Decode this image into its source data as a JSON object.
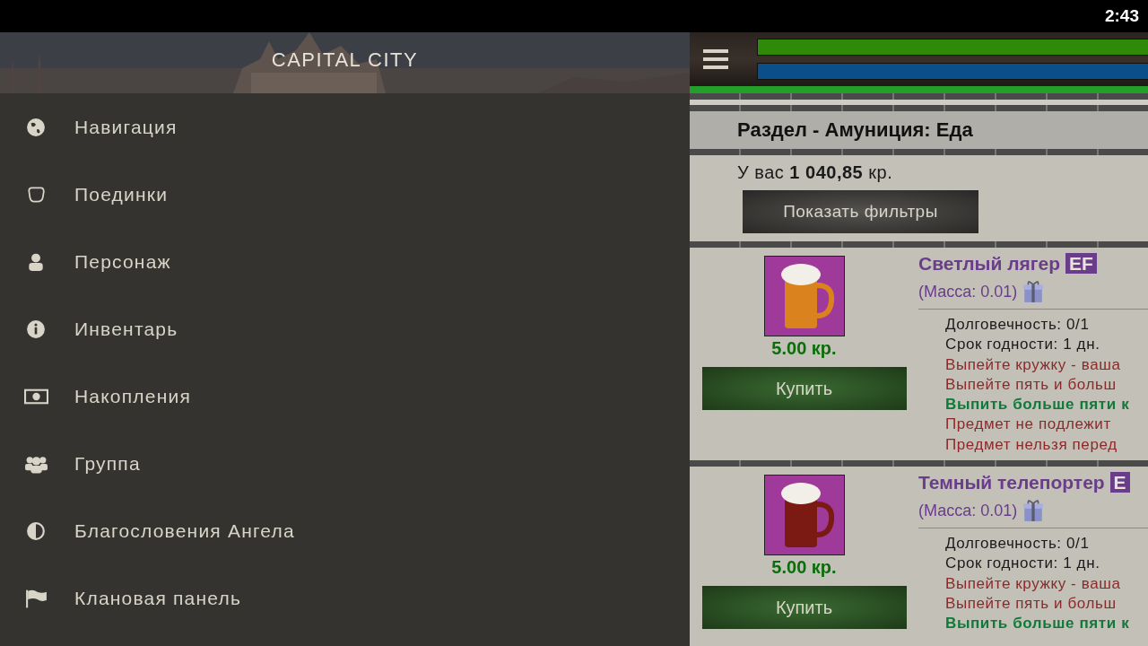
{
  "status_bar": {
    "time": "2:43"
  },
  "drawer": {
    "title": "CAPITAL CITY",
    "items": [
      {
        "label": "Навигация"
      },
      {
        "label": "Поединки"
      },
      {
        "label": "Персонаж"
      },
      {
        "label": "Инвентарь"
      },
      {
        "label": "Накопления"
      },
      {
        "label": "Группа"
      },
      {
        "label": "Благословения Ангела"
      },
      {
        "label": "Клановая панель"
      }
    ]
  },
  "top_bar": {
    "bars": [
      {
        "color": "#2f8a0a",
        "level": 1
      },
      {
        "color": "#0a4f8a",
        "level": 1
      }
    ]
  },
  "section_title": "Раздел - Амуниция: Еда",
  "balance": {
    "prefix": "У вас",
    "amount": "1 040,85",
    "suffix": "кр."
  },
  "filter_button": "Показать фильтры",
  "items": [
    {
      "name": "Светлый лягер",
      "badge": "EF",
      "mass": "(Масса: 0.01)",
      "price": "5.00 кр.",
      "buy": "Купить",
      "lines": [
        {
          "text": "Долговечность: 0/1",
          "kind": "stat"
        },
        {
          "text": "Срок годности: 1 дн.",
          "kind": "stat"
        },
        {
          "text": "Выпейте кружку - ваша",
          "kind": "warn"
        },
        {
          "text": "Выпейте пять и больш",
          "kind": "warn"
        },
        {
          "text": "Выпить больше пяти к",
          "kind": "good"
        },
        {
          "text": "Предмет не подлежит",
          "kind": "warn"
        },
        {
          "text": "Предмет нельзя перед",
          "kind": "warn"
        }
      ]
    },
    {
      "name": "Темный телепортер",
      "badge": "E",
      "mass": "(Масса: 0.01)",
      "price": "5.00 кр.",
      "buy": "Купить",
      "lines": [
        {
          "text": "Долговечность: 0/1",
          "kind": "stat"
        },
        {
          "text": "Срок годности: 1 дн.",
          "kind": "stat"
        },
        {
          "text": "Выпейте кружку - ваша",
          "kind": "warn"
        },
        {
          "text": "Выпейте пять и больш",
          "kind": "warn"
        },
        {
          "text": "Выпить больше пяти к",
          "kind": "good"
        }
      ]
    }
  ]
}
